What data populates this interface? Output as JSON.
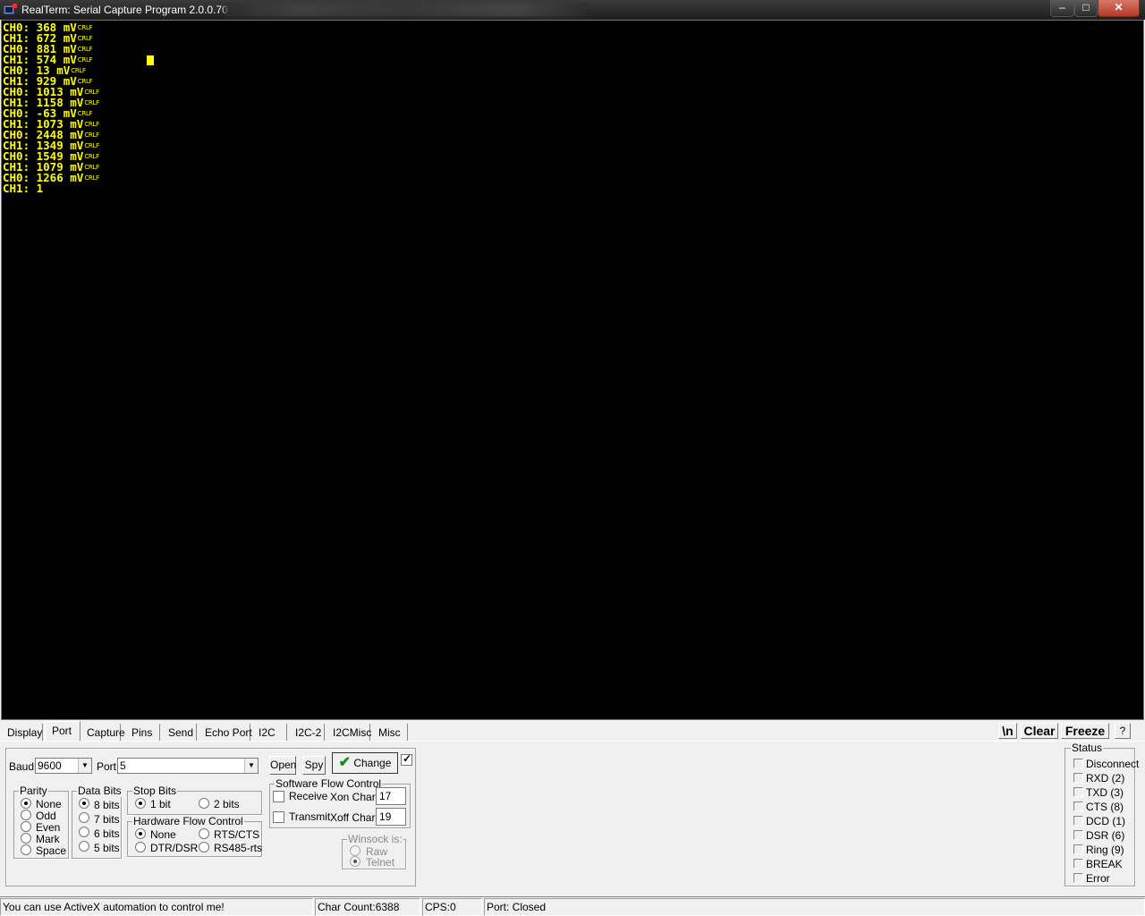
{
  "window": {
    "title": "RealTerm: Serial Capture Program 2.0.0.70",
    "minimize": "–",
    "maximize": "□",
    "close": "✕"
  },
  "terminal": {
    "crlf_marker": "CRLF",
    "lines": [
      {
        "text": "CH0: 368 mV",
        "crlf": true
      },
      {
        "text": "CH1: 672 mV",
        "crlf": true
      },
      {
        "text": "CH0: 881 mV",
        "crlf": true
      },
      {
        "text": "CH1: 574 mV",
        "crlf": true
      },
      {
        "text": "CH0: 13 mV",
        "crlf": true
      },
      {
        "text": "CH1: 929 mV",
        "crlf": true
      },
      {
        "text": "CH0: 1013 mV",
        "crlf": true
      },
      {
        "text": "CH1: 1158 mV",
        "crlf": true
      },
      {
        "text": "CH0: -63 mV",
        "crlf": true
      },
      {
        "text": "CH1: 1073 mV",
        "crlf": true
      },
      {
        "text": "CH0: 2448 mV",
        "crlf": true
      },
      {
        "text": "CH1: 1349 mV",
        "crlf": true
      },
      {
        "text": "CH0: 1549 mV",
        "crlf": true
      },
      {
        "text": "CH1: 1079 mV",
        "crlf": true
      },
      {
        "text": "CH0: 1266 mV",
        "crlf": true
      },
      {
        "text": "CH1: 1",
        "crlf": false
      }
    ]
  },
  "tabs": [
    "Display",
    "Port",
    "Capture",
    "Pins",
    "Send",
    "Echo Port",
    "I2C",
    "I2C-2",
    "I2CMisc",
    "Misc"
  ],
  "active_tab": "Port",
  "toolbar": {
    "newline": "\\n",
    "clear": "Clear",
    "freeze": "Freeze",
    "help": "?"
  },
  "port": {
    "baud_label": "Baud",
    "baud_value": "9600",
    "port_label": "Port",
    "port_value": "5",
    "open": "Open",
    "spy": "Spy",
    "change": "Change",
    "change_checked": true,
    "parity": {
      "title": "Parity",
      "options": [
        "None",
        "Odd",
        "Even",
        "Mark",
        "Space"
      ],
      "selected": "None"
    },
    "data_bits": {
      "title": "Data Bits",
      "options": [
        "8 bits",
        "7 bits",
        "6 bits",
        "5 bits"
      ],
      "selected": "8 bits"
    },
    "stop_bits": {
      "title": "Stop Bits",
      "options": [
        "1 bit",
        "2 bits"
      ],
      "selected": "1 bit"
    },
    "hw_flow": {
      "title": "Hardware Flow Control",
      "options": [
        "None",
        "RTS/CTS",
        "DTR/DSR",
        "RS485-rts"
      ],
      "selected": "None"
    },
    "sw_flow": {
      "title": "Software Flow Control",
      "receive": "Receive",
      "transmit": "Transmit",
      "xon_label": "Xon Char:",
      "xon_value": "17",
      "xoff_label": "Xoff Char:",
      "xoff_value": "19"
    },
    "winsock": {
      "title": "Winsock is:",
      "options": [
        "Raw",
        "Telnet"
      ],
      "selected": "Telnet"
    }
  },
  "status": {
    "title": "Status",
    "items": [
      "Disconnect",
      "RXD (2)",
      "TXD (3)",
      "CTS (8)",
      "DCD (1)",
      "DSR (6)",
      "Ring (9)",
      "BREAK",
      "Error"
    ]
  },
  "statusbar": {
    "message": "You can use ActiveX automation to control me!",
    "char_count": "Char Count:6388",
    "cps": "CPS:0",
    "port_state": "Port: Closed"
  }
}
